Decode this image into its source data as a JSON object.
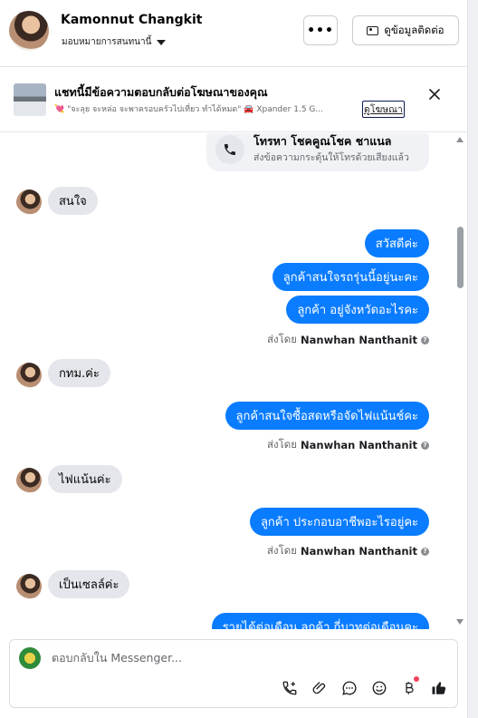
{
  "header": {
    "contact_name": "Kamonnut Changkit",
    "assign_label": "มอบหมายการสนทนานี้",
    "more_label": "•••",
    "contact_info_label": "ดูข้อมูลติดต่อ"
  },
  "ad_banner": {
    "title": "แชทนี้มีข้อความตอบกลับต่อโฆษณาของคุณ",
    "subtitle": "💘 \"จะลุย จะหล่อ จะพาครอบครัวไปเที่ยว ทำได้หมด\" 🚘 Xpander 1.5 G...",
    "link_label": "ดูโฆษณา",
    "close_label": "✕"
  },
  "call_card": {
    "title": "โทรหา โชคคูณโชค ชาแนล",
    "subtitle": "ส่งข้อความกระตุ้นให้โทรด้วยเสียงแล้ว"
  },
  "messages": [
    {
      "direction": "in",
      "text": "สนใจ"
    },
    {
      "direction": "out",
      "text": "สวัสดีค่ะ"
    },
    {
      "direction": "out",
      "text": "ลูกค้าสนใจรถรุ่นนี้อยู่นะคะ"
    },
    {
      "direction": "out",
      "text": "ลูกค้า อยู่จังหวัดอะไรคะ"
    },
    {
      "direction": "in",
      "text": "กทม.ค่ะ"
    },
    {
      "direction": "out",
      "text": "ลูกค้าสนใจซื้อสดหรือจัดไฟแน้นช์คะ"
    },
    {
      "direction": "in",
      "text": "ไฟแน้นค่ะ"
    },
    {
      "direction": "out",
      "text": "ลูกค้า ประกอบอาชีพอะไรอยู่คะ"
    },
    {
      "direction": "in",
      "text": "เป็นเซลล์ค่ะ"
    },
    {
      "direction": "out",
      "text": "รายได้ต่อเดือน ลูกค้า กี่บาทต่อเดือนคะ"
    }
  ],
  "sent_by": {
    "prefix": "ส่งโดย",
    "sender": "Nanwhan Nanthanit",
    "info": "?"
  },
  "composer": {
    "placeholder": "ตอบกลับใน Messenger..."
  },
  "icons": {
    "call": "phone-icon",
    "close": "close-icon",
    "attach": "paperclip-icon",
    "saved_replies": "chat-bubble-icon",
    "emoji": "smiley-icon",
    "payment": "baht-icon",
    "like": "thumbs-up-icon"
  },
  "colors": {
    "outgoing_bubble": "#0a7cff",
    "incoming_bubble": "#e4e6eb",
    "notification_dot": "#f3425f"
  }
}
